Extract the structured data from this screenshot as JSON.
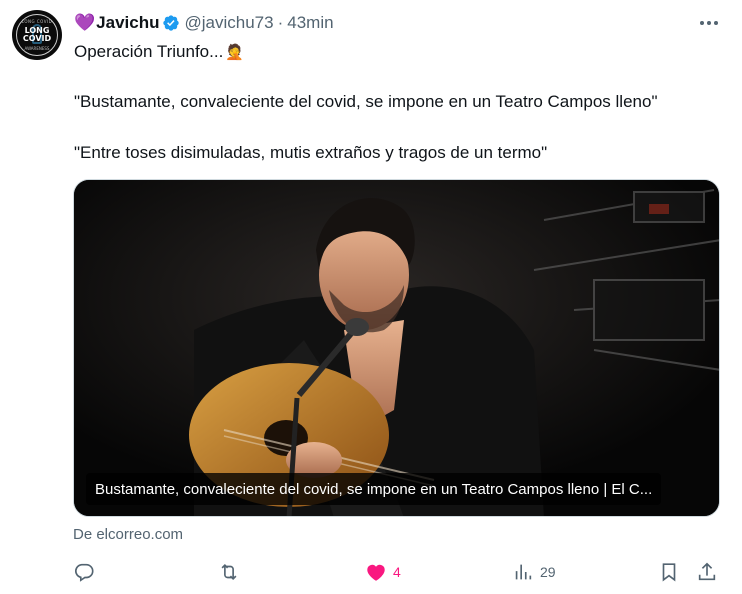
{
  "author": {
    "emoji": "💜",
    "display_name": "Javichu",
    "handle": "@javichu73",
    "separator": "·",
    "time": "43min",
    "verified": true,
    "avatar": {
      "top_text": "LONG COVID",
      "main_text": "LONG\nCOVID",
      "bottom_text": "AWARENESS"
    }
  },
  "tweet": {
    "line1": "Operación Triunfo...",
    "line1_emoji": "🤦",
    "line2": "\"Bustamante, convaleciente del covid, se impone en un Teatro Campos lleno\"",
    "line3": "\"Entre toses disimuladas, mutis extraños y tragos de un termo\""
  },
  "card": {
    "caption": "Bustamante, convaleciente del covid, se impone en un Teatro Campos lleno | El C...",
    "source": "De elcorreo.com"
  },
  "actions": {
    "reply_count": "",
    "retweet_count": "",
    "like_count": "4",
    "views_count": "29",
    "liked": true
  },
  "icons": [
    "more-icon",
    "verified-icon",
    "reply-icon",
    "retweet-icon",
    "like-icon",
    "views-icon",
    "bookmark-icon",
    "share-icon"
  ],
  "colors": {
    "like_active": "#f91880",
    "verified": "#1d9bf0",
    "muted": "#536471",
    "text": "#0f1419"
  }
}
